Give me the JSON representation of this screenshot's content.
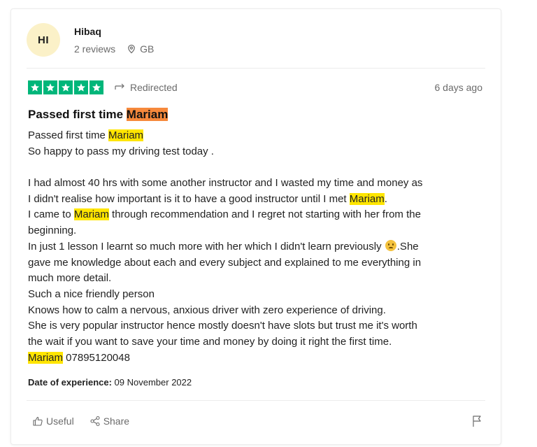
{
  "review": {
    "user": {
      "initials": "HI",
      "name": "Hibaq",
      "reviews": "2 reviews",
      "location": "GB"
    },
    "rating_stars": 5,
    "redirected_label": "Redirected",
    "date_ago": "6 days ago",
    "title_prefix": "Passed first time ",
    "title_highlight": "Mariam",
    "body": {
      "l1_a": "Passed first time ",
      "l1_hl": "Mariam",
      "l2": "So happy to pass my driving test today .",
      "l3": "I had almost 40 hrs with some another instructor and I wasted my time and money as",
      "l4_a": "I didn't realise how important is it to have a good instructor until I met ",
      "l4_hl": "Mariam",
      "l4_b": ".",
      "l5_a": "I came to ",
      "l5_hl": "Mariam",
      "l5_b": " through recommendation and I regret not starting with her from the",
      "l6": "beginning.",
      "l7_a": "In just 1 lesson I learnt so much more with her which I didn't learn previously ",
      "l7_b": ".She",
      "l8": "gave me knowledge about each and every subject and explained to me everything in",
      "l9": "much more detail.",
      "l10": "Such a nice friendly person",
      "l11": "Knows how to calm a nervous, anxious driver with zero experience of driving.",
      "l12": "She is very popular instructor hence mostly doesn't have slots but trust me it's worth",
      "l13": "the wait if you want to save your time and money by doing it right the first time.",
      "l14_hl": "Mariam",
      "l14_b": " 07895120048"
    },
    "experience_label": "Date of experience:",
    "experience_date": " 09 November 2022",
    "useful_label": "Useful",
    "share_label": "Share"
  },
  "colors": {
    "star_green": "#00b67a",
    "highlight_yellow": "#ffe500",
    "highlight_orange": "#f6893c",
    "avatar_bg": "#fbf1c8"
  },
  "icons": [
    "location-icon",
    "redirect-arrow-icon",
    "star-icon",
    "emoji-sad-icon",
    "thumbs-up-icon",
    "share-icon",
    "flag-icon"
  ]
}
